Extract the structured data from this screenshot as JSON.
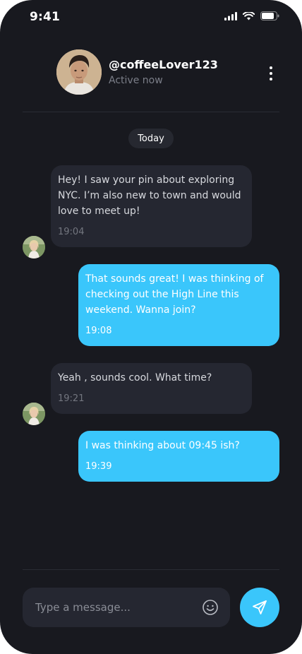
{
  "status_bar": {
    "time": "9:41",
    "icons": [
      "signal-icon",
      "wifi-icon",
      "battery-icon"
    ]
  },
  "header": {
    "username": "@coffeeLover123",
    "status": "Active now",
    "menu_icon": "more-vertical-icon"
  },
  "date_label": "Today",
  "messages": [
    {
      "direction": "incoming",
      "text": "Hey! I saw your pin about exploring NYC. I’m also new to town and would love to meet up!",
      "time": "19:04"
    },
    {
      "direction": "outgoing",
      "text": "That sounds great! I was thinking of checking out the High Line this weekend. Wanna join?",
      "time": "19:08"
    },
    {
      "direction": "incoming",
      "text": "Yeah , sounds cool. What time?",
      "time": "19:21"
    },
    {
      "direction": "outgoing",
      "text": "I was thinking about 09:45 ish?",
      "time": "19:39"
    }
  ],
  "composer": {
    "placeholder": "Type a message...",
    "value": "",
    "emoji_icon": "emoji-smile-icon",
    "send_icon": "send-icon"
  },
  "colors": {
    "background": "#18191f",
    "incoming_bubble": "#252731",
    "outgoing_bubble": "#3ac6fb",
    "accent": "#3ac6fb"
  }
}
